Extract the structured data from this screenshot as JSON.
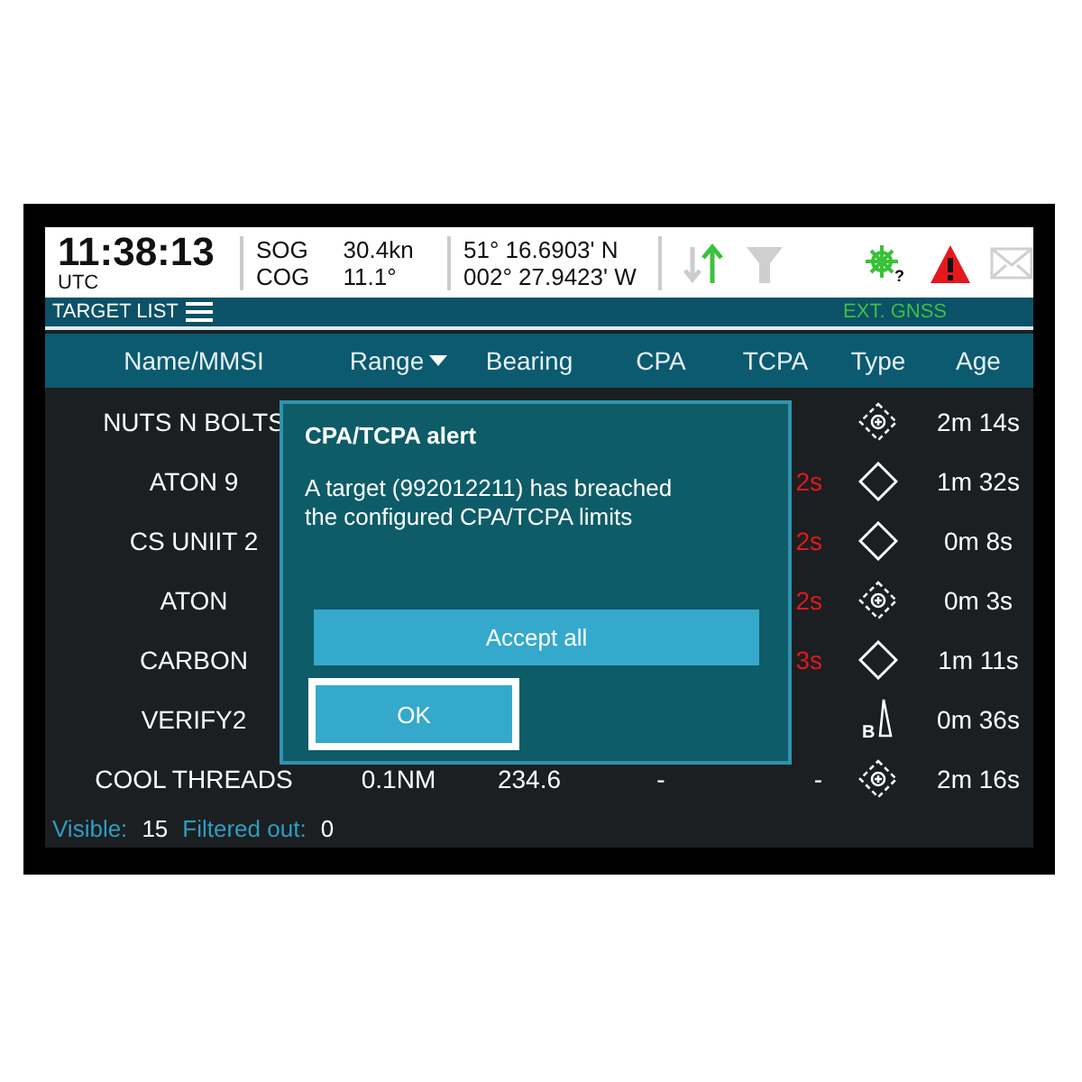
{
  "status": {
    "time": "11:38:13",
    "timezone": "UTC",
    "sog_label": "SOG",
    "sog": "30.4kn",
    "cog_label": "COG",
    "cog": "11.1°",
    "latitude": "51° 16.6903' N",
    "longitude": "002° 27.9423' W",
    "wheel_badge": "?"
  },
  "panel": {
    "title": "TARGET LIST",
    "source": "EXT. GNSS"
  },
  "table": {
    "columns": [
      {
        "label": "Name/MMSI",
        "sorted": false
      },
      {
        "label": "Range",
        "sorted": true
      },
      {
        "label": "Bearing",
        "sorted": false
      },
      {
        "label": "CPA",
        "sorted": false
      },
      {
        "label": "TCPA",
        "sorted": false
      },
      {
        "label": "Type",
        "sorted": false
      },
      {
        "label": "Age",
        "sorted": false
      }
    ],
    "rows": [
      {
        "name": "NUTS N BOLTS",
        "kind": "aton",
        "age": "2m 14s"
      },
      {
        "name": "ATON 9",
        "tcpa": "2s",
        "tcpa_alarm": true,
        "kind": "vessel",
        "age": "1m 32s"
      },
      {
        "name": "CS UNIIT 2",
        "tcpa": "2s",
        "tcpa_alarm": true,
        "kind": "vessel",
        "age": "0m 8s"
      },
      {
        "name": "ATON",
        "tcpa": "2s",
        "tcpa_alarm": true,
        "kind": "aton",
        "age": "0m 3s"
      },
      {
        "name": "CARBON",
        "tcpa": "3s",
        "tcpa_alarm": true,
        "kind": "vessel",
        "age": "1m 11s"
      },
      {
        "name": "VERIFY2",
        "kind": "base",
        "type_letter": "B",
        "age": "0m 36s"
      },
      {
        "name": "COOL THREADS",
        "range": "0.1NM",
        "bearing": "234.6",
        "cpa": "-",
        "tcpa": "-",
        "tcpa_alarm": false,
        "kind": "aton",
        "age": "2m 16s"
      }
    ]
  },
  "footer": {
    "visible_label": "Visible:",
    "visible": "15",
    "filtered_label": "Filtered out:",
    "filtered": "0"
  },
  "dialog": {
    "title": "CPA/TCPA alert",
    "message": "A target (992012211) has breached the configured CPA/TCPA limits",
    "buttons": [
      {
        "label": "Accept all",
        "focused": false
      },
      {
        "label": "OK",
        "focused": true
      }
    ]
  }
}
